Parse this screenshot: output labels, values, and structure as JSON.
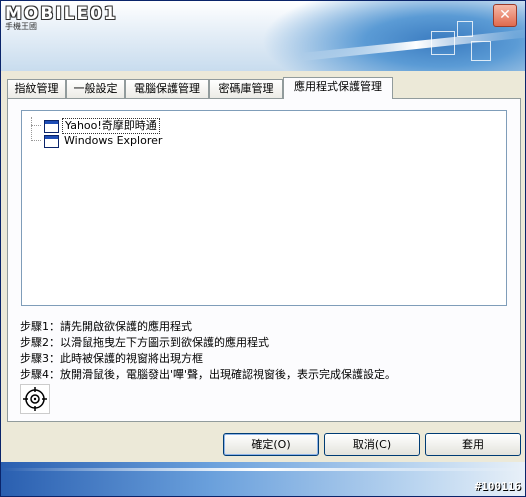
{
  "window": {
    "logo_text": "MOBILE01",
    "sub_logo": "手機王國",
    "close_label": "✕"
  },
  "tabs": [
    {
      "label": "指紋管理"
    },
    {
      "label": "一般設定"
    },
    {
      "label": "電腦保護管理"
    },
    {
      "label": "密碼庫管理"
    },
    {
      "label": "應用程式保護管理"
    }
  ],
  "tree": {
    "items": [
      {
        "label": "Yahoo!奇摩即時通",
        "icon": "window-icon",
        "selected": true
      },
      {
        "label": "Windows Explorer",
        "icon": "window-icon",
        "selected": false
      }
    ]
  },
  "steps": [
    "步驟1：請先開啟欲保護的應用程式",
    "步驟2：以滑鼠拖曳左下方圖示到欲保護的應用程式",
    "步驟3：此時被保護的視窗將出現方框",
    "步驟4：放開滑鼠後，電腦發出'嗶'聲，出現確認視窗後，表示完成保護設定。"
  ],
  "buttons": {
    "ok": "確定(O)",
    "cancel": "取消(C)",
    "apply": "套用"
  },
  "watermark": "#100116"
}
